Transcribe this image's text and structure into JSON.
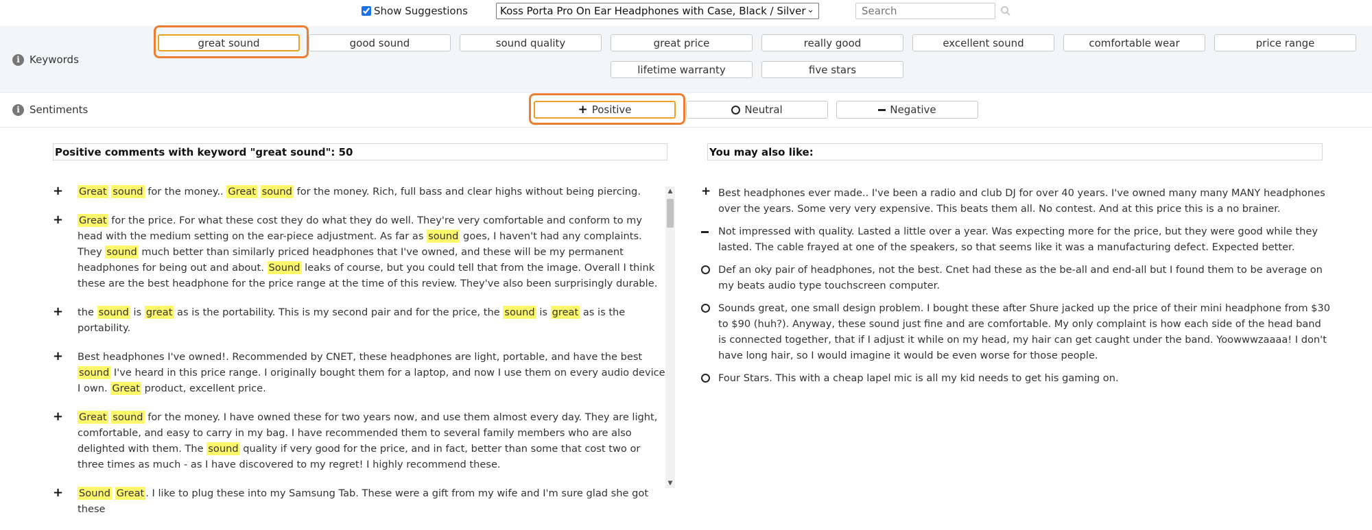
{
  "topbar": {
    "show_suggestions_label": "Show Suggestions",
    "show_suggestions_checked": true,
    "product_selected": "Koss Porta Pro On Ear Headphones with Case, Black / Silver",
    "search_placeholder": "Search"
  },
  "keywords": {
    "label": "Keywords",
    "items": [
      "great sound",
      "good sound",
      "sound quality",
      "great price",
      "really good",
      "excellent sound",
      "comfortable wear",
      "price range",
      "lifetime warranty",
      "five stars"
    ],
    "selected": "great sound"
  },
  "sentiments": {
    "label": "Sentiments",
    "items": [
      {
        "label": "Positive",
        "icon": "plus-icon"
      },
      {
        "label": "Neutral",
        "icon": "circle-icon"
      },
      {
        "label": "Negative",
        "icon": "minus-icon"
      }
    ],
    "selected": "Positive"
  },
  "comments_panel": {
    "header": "Positive comments with keyword \"great sound\": 50",
    "comments": [
      {
        "sentiment": "positive",
        "parts": [
          [
            "Great",
            true
          ],
          [
            " ",
            false
          ],
          [
            "sound",
            true
          ],
          [
            " for the money.. ",
            false
          ],
          [
            "Great",
            true
          ],
          [
            " ",
            false
          ],
          [
            "sound",
            true
          ],
          [
            " for the money. Rich, full bass and clear highs without being piercing.",
            false
          ]
        ]
      },
      {
        "sentiment": "positive",
        "parts": [
          [
            "Great",
            true
          ],
          [
            " for the price. For what these cost they do what they do well. They're very comfortable and conform to my head with the medium setting on the ear-piece adjustment. As far as ",
            false
          ],
          [
            "sound",
            true
          ],
          [
            " goes, I haven't had any complaints. They ",
            false
          ],
          [
            "sound",
            true
          ],
          [
            " much better than similarly priced headphones that I've owned, and these will be my permanent headphones for being out and about. ",
            false
          ],
          [
            "Sound",
            true
          ],
          [
            " leaks of course, but you could tell that from the image. Overall I think these are the best headphone for the price range at the time of this review. They've also been surprisingly durable.",
            false
          ]
        ]
      },
      {
        "sentiment": "positive",
        "parts": [
          [
            "the ",
            false
          ],
          [
            "sound",
            true
          ],
          [
            " is ",
            false
          ],
          [
            "great",
            true
          ],
          [
            " as is the portability. This is my second pair and for the price, the ",
            false
          ],
          [
            "sound",
            true
          ],
          [
            " is ",
            false
          ],
          [
            "great",
            true
          ],
          [
            " as is the portability.",
            false
          ]
        ]
      },
      {
        "sentiment": "positive",
        "parts": [
          [
            "Best headphones I've owned!. Recommended by CNET, these headphones are light, portable, and have the best ",
            false
          ],
          [
            "sound",
            true
          ],
          [
            " I've heard in this price range. I originally bought them for a laptop, and now I use them on every audio device I own. ",
            false
          ],
          [
            "Great",
            true
          ],
          [
            " product, excellent price.",
            false
          ]
        ]
      },
      {
        "sentiment": "positive",
        "parts": [
          [
            "Great",
            true
          ],
          [
            " ",
            false
          ],
          [
            "sound",
            true
          ],
          [
            " for the money. I have owned these for two years now, and use them almost every day. They are light, comfortable, and easy to carry in my bag. I have recommended them to several family members who are also delighted with them. The ",
            false
          ],
          [
            "sound",
            true
          ],
          [
            " quality if very good for the price, and in fact, better than some that cost two or three times as much - as I have discovered to my regret! I highly recommend these.",
            false
          ]
        ]
      },
      {
        "sentiment": "positive",
        "parts": [
          [
            "Sound",
            true
          ],
          [
            " ",
            false
          ],
          [
            "Great",
            true
          ],
          [
            ". I like to plug these into my Samsung Tab. These were a gift from my wife and I'm sure glad she got these",
            false
          ]
        ]
      }
    ]
  },
  "suggestions_panel": {
    "header": "You may also like:",
    "items": [
      {
        "sentiment": "positive",
        "text": "Best headphones ever made.. I've been a radio and club DJ for over 40 years. I've owned many many MANY headphones over the years. Some very very expensive. This beats them all. No contest. And at this price this is a no brainer."
      },
      {
        "sentiment": "negative",
        "text": "Not impressed with quality. Lasted a little over a year. Was expecting more for the price, but they were good while they lasted. The cable frayed at one of the speakers, so that seems like it was a manufacturing defect. Expected better."
      },
      {
        "sentiment": "neutral",
        "text": "Def an oky pair of headphones, not the best. Cnet had these as the be-all and end-all but I found them to be average on my beats audio type touchscreen computer."
      },
      {
        "sentiment": "neutral",
        "text": "Sounds great, one small design problem. I bought these after Shure jacked up the price of their mini headphone from $30 to $90 (huh?). Anyway, these sound just fine and are comfortable. My only complaint is how each side of the head band is connected together, that if I adjust it while on my head, my hair can get caught under the band. Yoowwwzaaaa! I don't have long hair, so I would imagine it would be even worse for those people."
      },
      {
        "sentiment": "neutral",
        "text": "Four Stars. This with a cheap lapel mic is all my kid needs to get his gaming on."
      }
    ]
  },
  "colors": {
    "highlight": "#fff86a",
    "selected_border": "#f0a020",
    "annotation_frame": "#ed7d31",
    "band_background": "#f3f6f9"
  }
}
